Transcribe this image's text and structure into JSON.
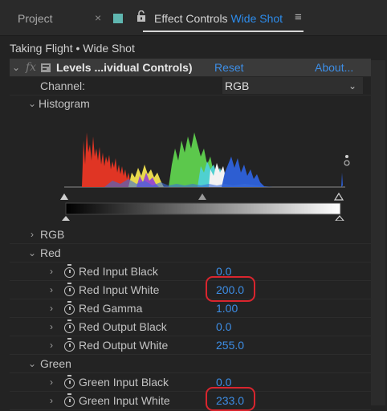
{
  "tabs": {
    "project": "Project",
    "close_glyph": "×",
    "effect_controls_prefix": "Effect Controls",
    "effect_controls_clip": "Wide Shot",
    "menu_glyph": "≡"
  },
  "panel": {
    "comp_title": "Taking Flight • Wide Shot",
    "effect": {
      "fx": "fx",
      "name": "Levels ...ividual Controls)",
      "reset": "Reset",
      "about": "About..."
    },
    "channel": {
      "label": "Channel:",
      "value": "RGB"
    },
    "histogram": {
      "label": "Histogram"
    },
    "groups": [
      {
        "label": "RGB",
        "expanded": false
      },
      {
        "label": "Red",
        "expanded": true
      },
      {
        "label": "Green",
        "expanded": true
      }
    ],
    "red_props": [
      {
        "label": "Red Input Black",
        "value": "0.0",
        "highlighted": false
      },
      {
        "label": "Red Input White",
        "value": "200.0",
        "highlighted": true
      },
      {
        "label": "Red Gamma",
        "value": "1.00",
        "highlighted": false
      },
      {
        "label": "Red Output Black",
        "value": "0.0",
        "highlighted": false
      },
      {
        "label": "Red Output White",
        "value": "255.0",
        "highlighted": false
      }
    ],
    "green_props": [
      {
        "label": "Green Input Black",
        "value": "0.0",
        "highlighted": false
      },
      {
        "label": "Green Input White",
        "value": "233.0",
        "highlighted": true
      }
    ]
  },
  "colors": {
    "accent_blue": "#3d8ee6",
    "highlight_red": "#d9252e",
    "tab_label_swatch": "#5fb6b0"
  }
}
